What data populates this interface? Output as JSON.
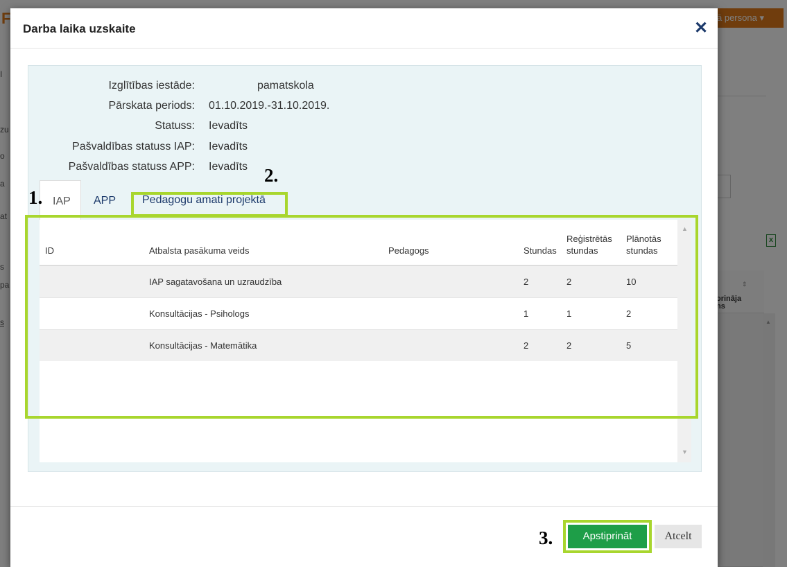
{
  "background": {
    "brand_letter": "F",
    "persona_label": "ā persona",
    "persona_caret": "▾",
    "table_header_partial": "orināja\nns",
    "left_fragments": [
      "I",
      "zu",
      "o",
      "a",
      "at",
      "s",
      "pa",
      "s"
    ]
  },
  "modal": {
    "title": "Darba laika uzskaite",
    "close_glyph": "✕"
  },
  "info": [
    {
      "label": "Izglītības iestāde:",
      "value": "pamatskola"
    },
    {
      "label": "Pārskata periods:",
      "value": "01.10.2019.-31.10.2019."
    },
    {
      "label": "Statuss:",
      "value": "Ievadīts"
    },
    {
      "label": "Pašvaldības statuss IAP:",
      "value": "Ievadīts"
    },
    {
      "label": "Pašvaldības statuss APP:",
      "value": "Ievadīts"
    }
  ],
  "tabs": [
    {
      "label": "IAP",
      "active": true
    },
    {
      "label": "APP",
      "active": false
    },
    {
      "label": "Pedagogu amati projektā",
      "active": false
    }
  ],
  "annotations": {
    "one": "1.",
    "two": "2.",
    "three": "3."
  },
  "icons": {
    "excel": "excel-export-icon",
    "excel_glyph": "x",
    "print": "print-icon"
  },
  "table": {
    "headers": {
      "id": "ID",
      "type": "Atbalsta pasākuma veids",
      "teacher": "Pedagogs",
      "hours": "Stundas",
      "registered_l1": "Reģistrētās",
      "registered_l2": "stundas",
      "planned_l1": "Plānotās",
      "planned_l2": "stundas"
    },
    "rows": [
      {
        "id": "",
        "type": "IAP sagatavošana un uzraudzība",
        "teacher": "",
        "hours": "2",
        "registered": "2",
        "planned": "10"
      },
      {
        "id": "",
        "type": "Konsultācijas - Psihologs",
        "teacher": "",
        "hours": "1",
        "registered": "1",
        "planned": "2"
      },
      {
        "id": "",
        "type": "Konsultācijas - Matemātika",
        "teacher": "",
        "hours": "2",
        "registered": "2",
        "planned": "5"
      }
    ]
  },
  "footer": {
    "confirm_label": "Apstiprināt",
    "cancel_label": "Atcelt"
  },
  "colors": {
    "highlight": "#a8d62e",
    "confirm_bg": "#1e9e48",
    "link": "#1c3a6b",
    "panel_bg": "#eaf4f6"
  }
}
